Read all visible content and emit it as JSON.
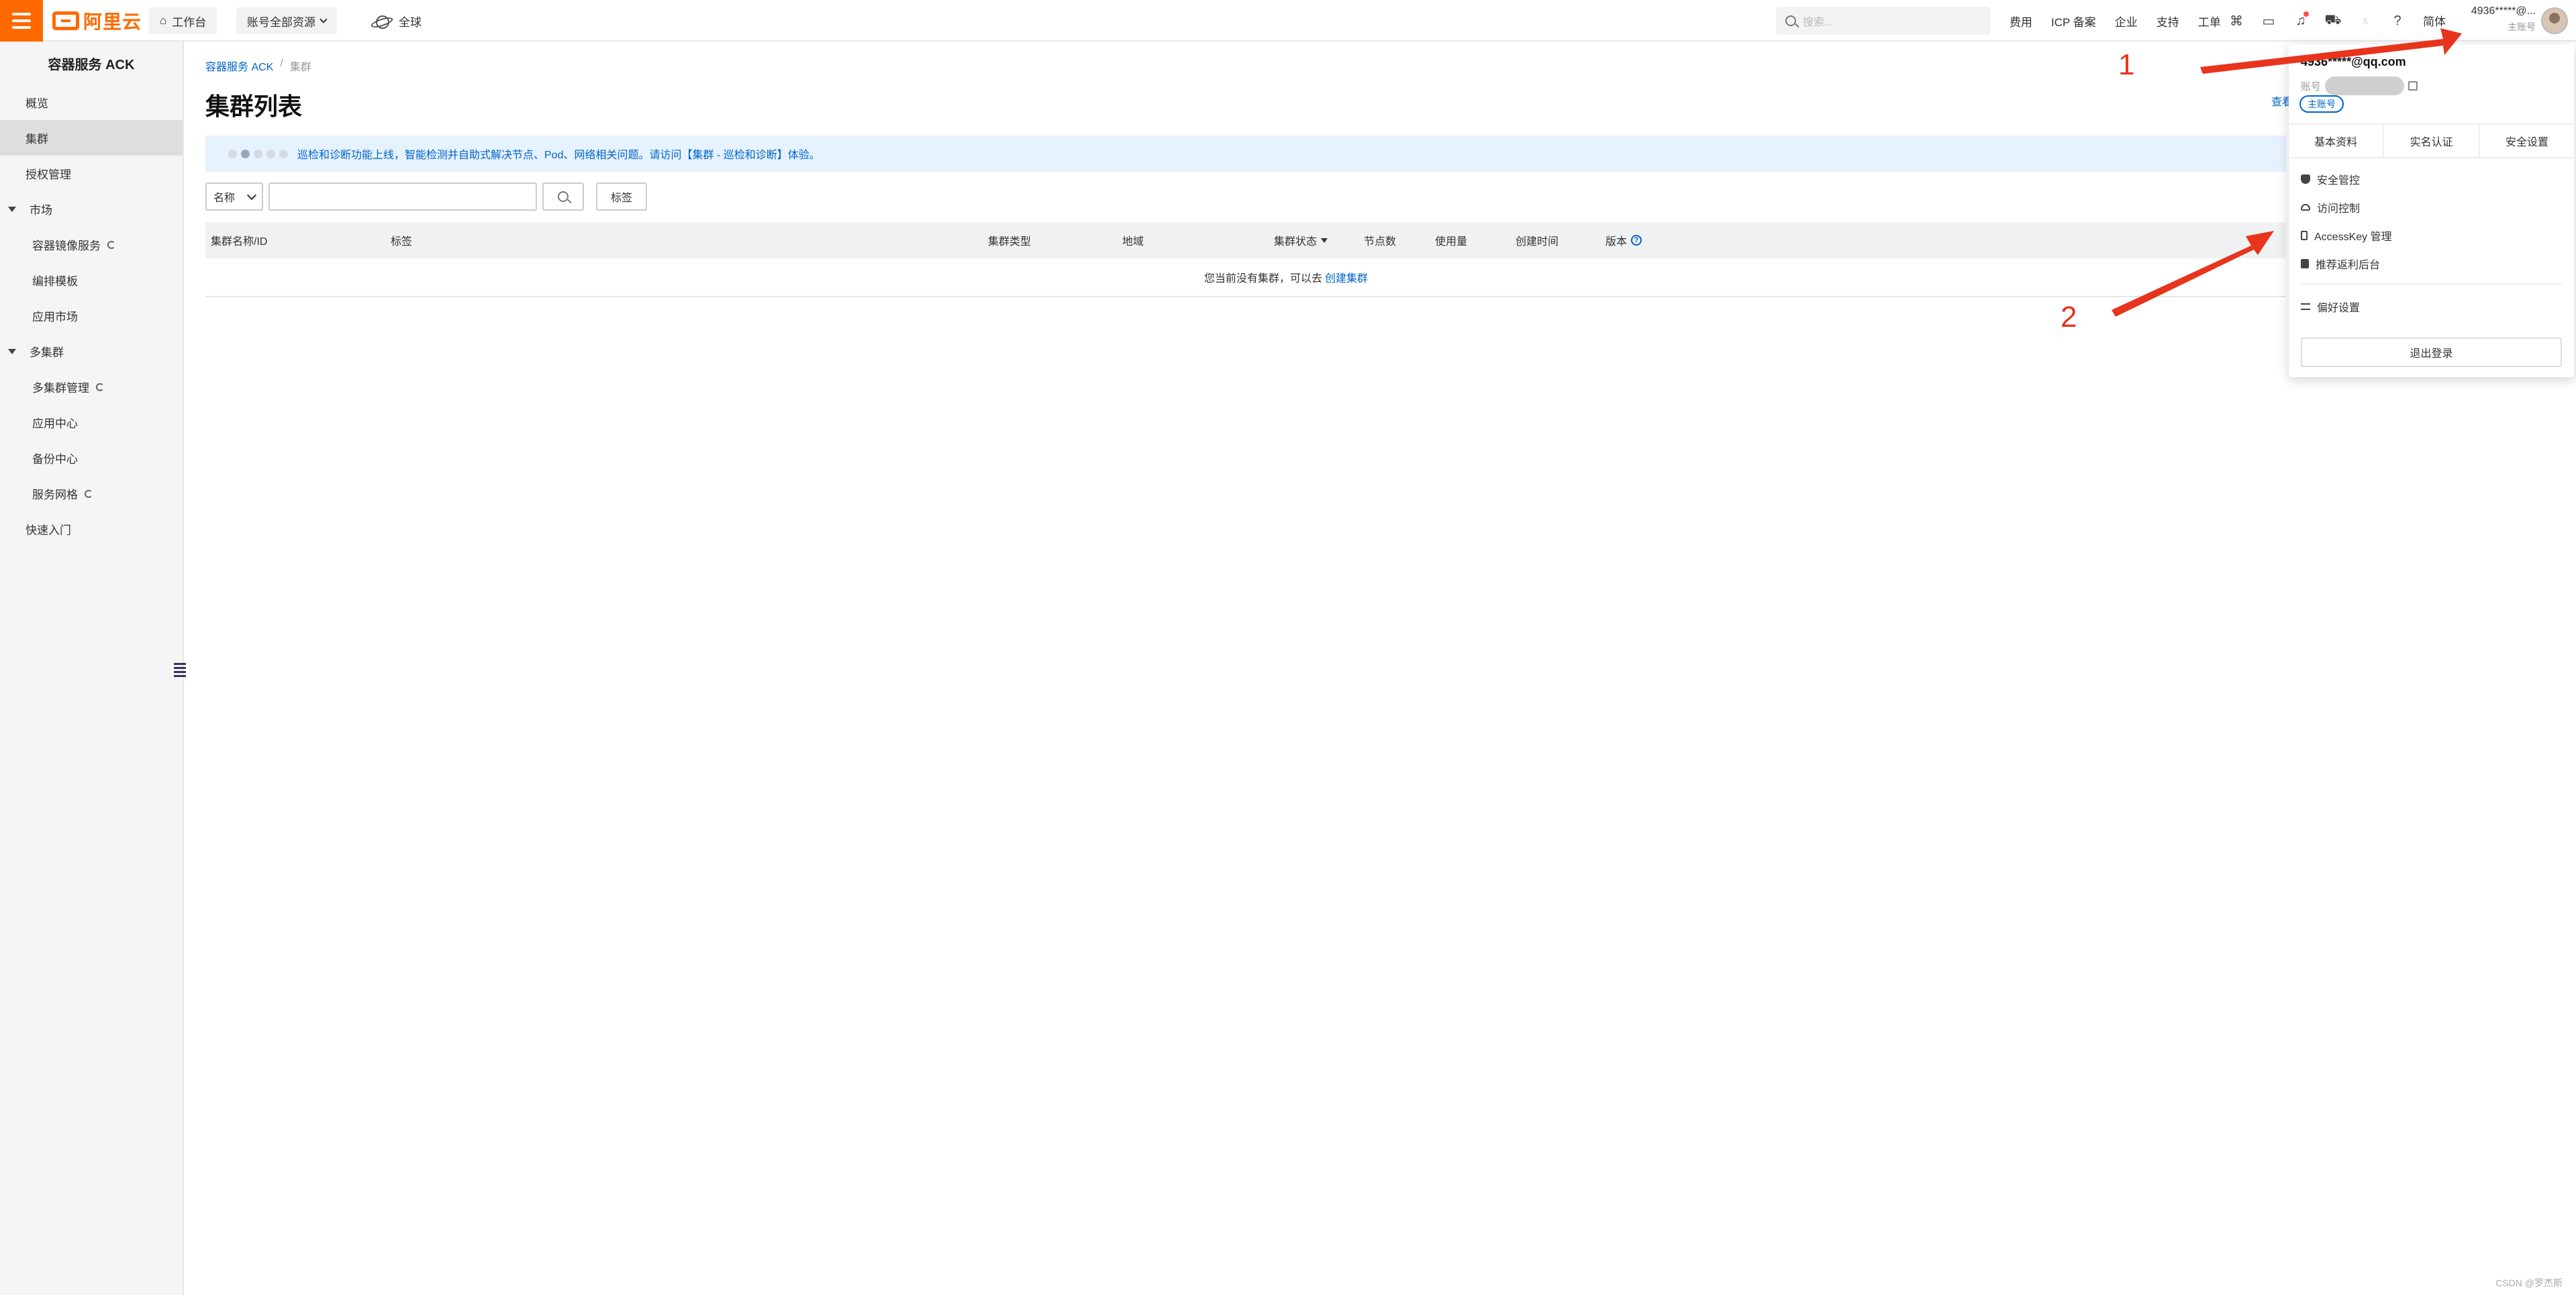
{
  "topbar": {
    "logo_text": "阿里云",
    "workbench": "工作台",
    "resources": "账号全部资源",
    "region": "全球",
    "search_placeholder": "搜索...",
    "links": [
      "费用",
      "ICP 备案",
      "企业",
      "支持",
      "工单"
    ],
    "lang": "简体",
    "user_name": "4936*****@...",
    "user_role": "主账号"
  },
  "sidebar": {
    "title": "容器服务 ACK",
    "items": [
      {
        "label": "概览"
      },
      {
        "label": "集群"
      },
      {
        "label": "授权管理"
      },
      {
        "label": "市场"
      },
      {
        "label": "容器镜像服务"
      },
      {
        "label": "编排模板"
      },
      {
        "label": "应用市场"
      },
      {
        "label": "多集群"
      },
      {
        "label": "多集群管理"
      },
      {
        "label": "应用中心"
      },
      {
        "label": "备份中心"
      },
      {
        "label": "服务网格"
      },
      {
        "label": "快速入门"
      }
    ]
  },
  "main": {
    "breadcrumb": [
      "容器服务 ACK",
      "/",
      "集群"
    ],
    "title": "集群列表",
    "banner": "巡检和诊断功能上线，智能检测并自助式解决节点、Pod、网络相关问题。请访问【集群 - 巡检和诊断】体验。",
    "filter_select": "名称",
    "tag_button": "标签",
    "cut_link": "查看",
    "columns": [
      "集群名称/ID",
      "标签",
      "集群类型",
      "地域",
      "集群状态",
      "节点数",
      "使用量",
      "创建时间",
      "版本"
    ],
    "empty_text": "您当前没有集群，可以去",
    "empty_link": "创建集群"
  },
  "dropdown": {
    "email": "4936*****@qq.com",
    "account_label": "账号",
    "badge": "主账号",
    "tabs": [
      "基本资料",
      "实名认证",
      "安全设置"
    ],
    "items": [
      "安全管控",
      "访问控制",
      "AccessKey 管理",
      "推荐返利后台"
    ],
    "preferences": "偏好设置",
    "logout": "退出登录"
  },
  "annotations": {
    "label_1": "1",
    "label_2": "2",
    "arrow_color": "#e8341c"
  },
  "watermark": "CSDN @罗杰斯"
}
